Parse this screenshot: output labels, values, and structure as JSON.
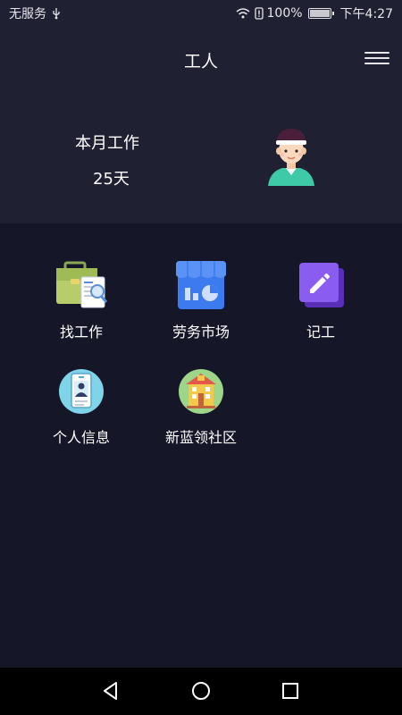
{
  "status_bar": {
    "carrier": "无服务",
    "battery": "100%",
    "time": "下午4:27"
  },
  "header": {
    "title": "工人",
    "menu_icon": "hamburger-menu-icon",
    "month_label": "本月工作",
    "month_value": "25天",
    "avatar_icon": "worker-avatar-icon"
  },
  "tiles": [
    {
      "label": "找工作",
      "icon": "briefcase-document-icon"
    },
    {
      "label": "劳务市场",
      "icon": "storefront-chart-icon"
    },
    {
      "label": "记工",
      "icon": "pencil-note-icon"
    },
    {
      "label": "个人信息",
      "icon": "id-card-icon"
    },
    {
      "label": "新蓝领社区",
      "icon": "community-building-icon"
    }
  ],
  "nav": {
    "back_icon": "back-triangle-icon",
    "home_icon": "home-circle-icon",
    "recents_icon": "recents-square-icon"
  },
  "colors": {
    "background": "#151628",
    "header_bg": "#1f2032",
    "accent_purple": "#7a4ddb",
    "accent_blue": "#3b7bef"
  }
}
